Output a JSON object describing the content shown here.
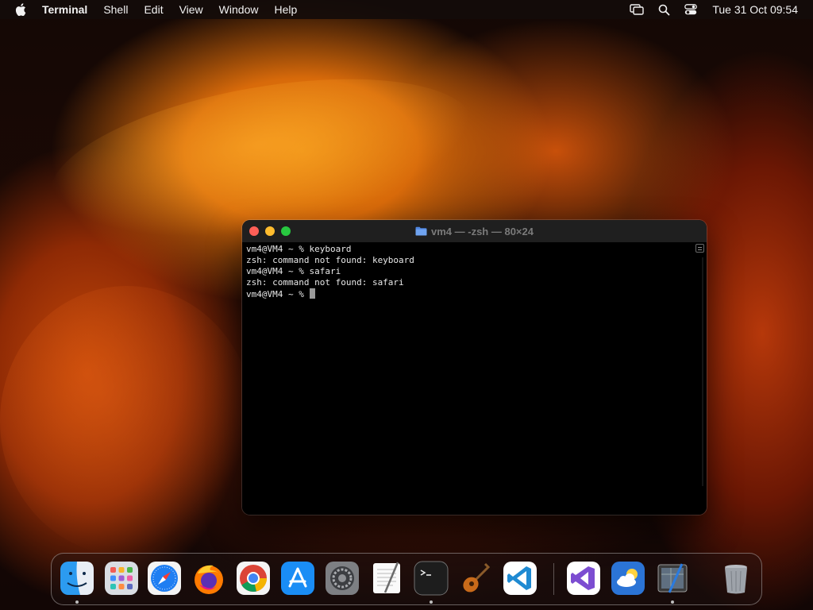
{
  "menubar": {
    "apple_icon": "apple-logo-icon",
    "app_name": "Terminal",
    "items": [
      "Shell",
      "Edit",
      "View",
      "Window",
      "Help"
    ],
    "status_icons": [
      "screen-mirroring-icon",
      "search-icon",
      "control-center-icon"
    ],
    "clock": "Tue 31 Oct  09:54"
  },
  "terminal": {
    "title": "vm4 — -zsh — 80×24",
    "title_icon": "folder-icon",
    "lines": [
      "vm4@VM4 ~ % keyboard",
      "zsh: command not found: keyboard",
      "vm4@VM4 ~ % safari",
      "zsh: command not found: safari",
      "vm4@VM4 ~ % "
    ],
    "colors": {
      "background": "#000000",
      "text": "#e8e8e8",
      "close": "#ff5f57",
      "minimize": "#febc2e",
      "maximize": "#28c840"
    }
  },
  "dock": {
    "apps": [
      {
        "name": "Finder",
        "icon": "finder-icon",
        "running": true
      },
      {
        "name": "Launchpad",
        "icon": "launchpad-icon",
        "running": false
      },
      {
        "name": "Safari",
        "icon": "safari-icon",
        "running": false
      },
      {
        "name": "Firefox",
        "icon": "firefox-icon",
        "running": false
      },
      {
        "name": "Google Chrome",
        "icon": "chrome-icon",
        "running": false
      },
      {
        "name": "App Store",
        "icon": "app-store-icon",
        "running": false
      },
      {
        "name": "System Settings",
        "icon": "system-settings-icon",
        "running": false
      },
      {
        "name": "TextEdit",
        "icon": "textedit-icon",
        "running": false
      },
      {
        "name": "Terminal",
        "icon": "terminal-icon",
        "running": true
      },
      {
        "name": "GarageBand",
        "icon": "garageband-icon",
        "running": false
      },
      {
        "name": "Visual Studio Code",
        "icon": "vscode-icon",
        "running": false
      },
      {
        "name": "Visual Studio",
        "icon": "visual-studio-icon",
        "running": false
      },
      {
        "name": "Weather",
        "icon": "weather-icon",
        "running": false
      },
      {
        "name": "Preview",
        "icon": "preview-icon",
        "running": true
      }
    ],
    "trash_icon": "trash-icon"
  }
}
